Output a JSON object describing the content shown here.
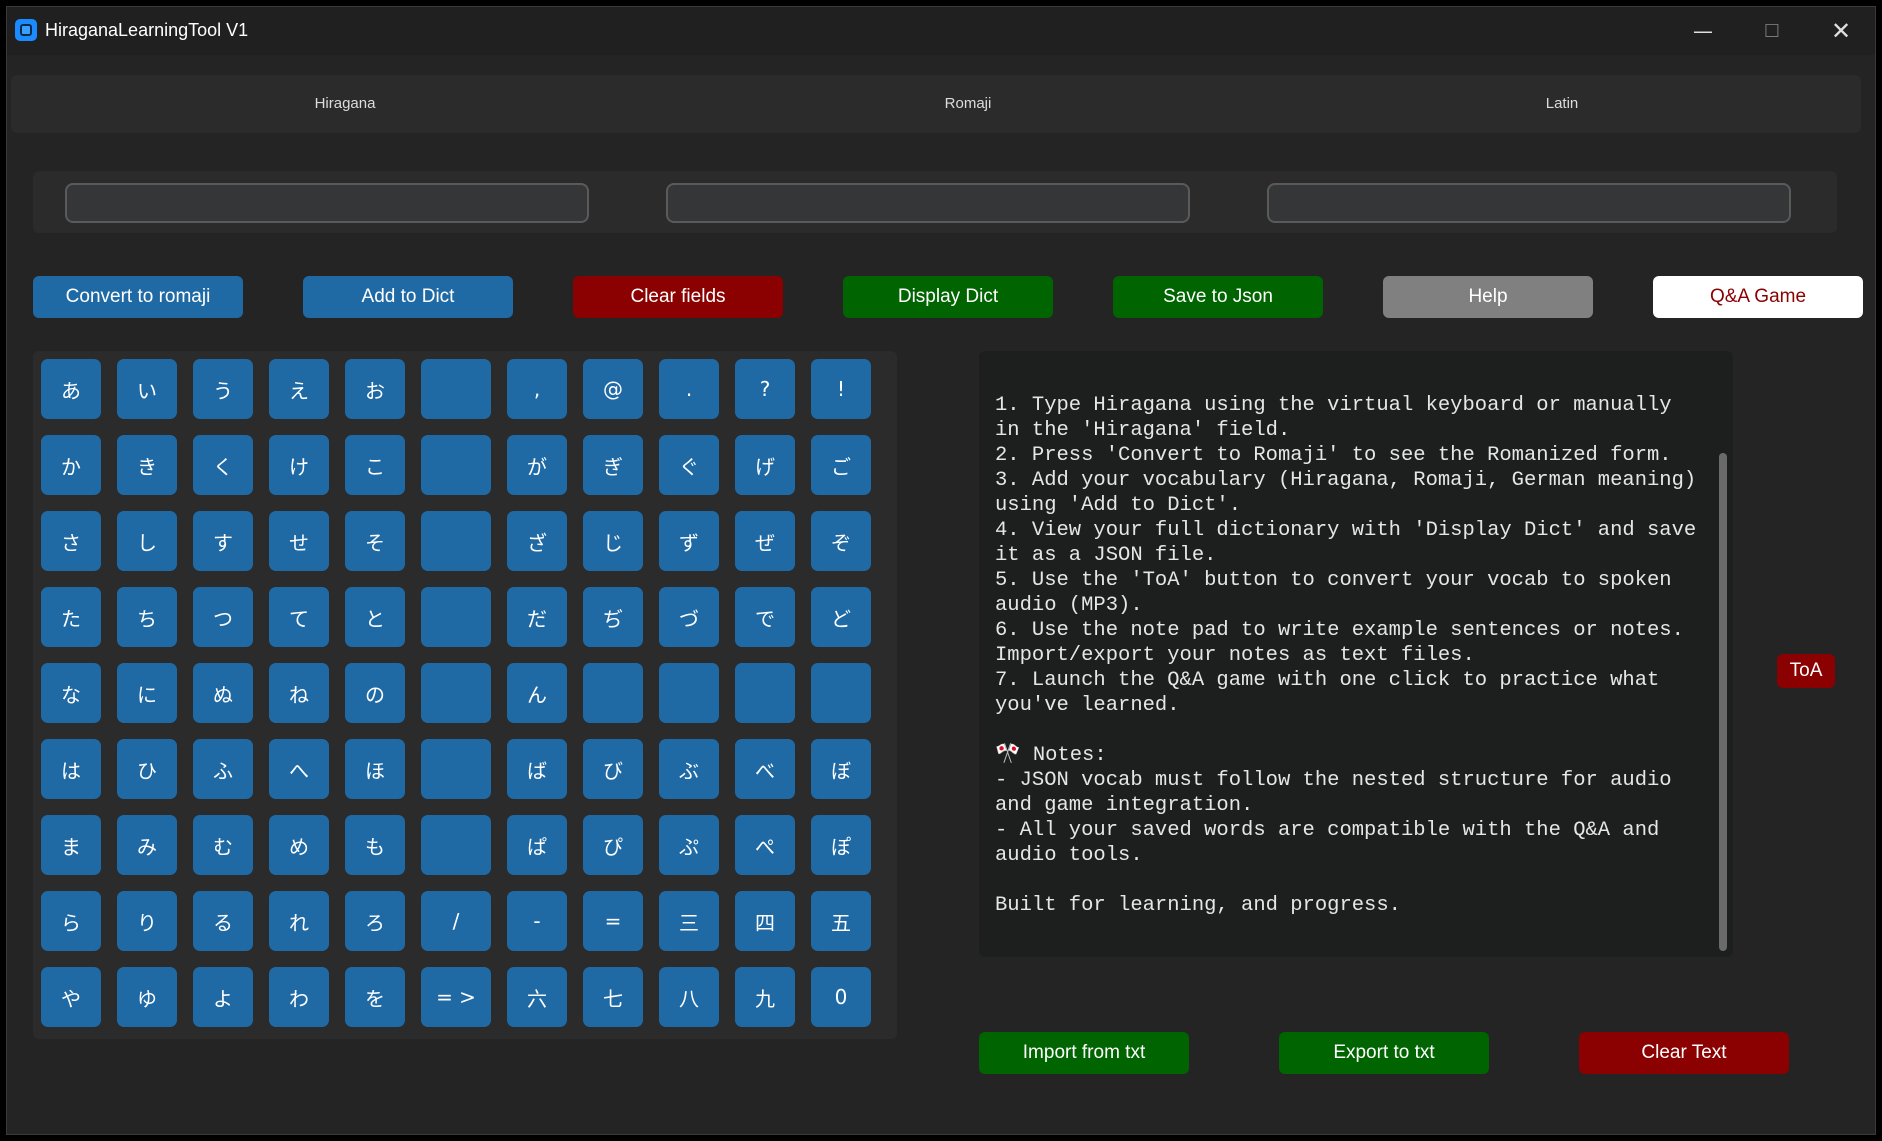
{
  "window": {
    "title": "HiraganaLearningTool V1",
    "minimize": "—",
    "maximize": "☐",
    "close": "✕"
  },
  "header": {
    "labels": [
      "Hiragana",
      "Romaji",
      "Latin"
    ]
  },
  "fields": {
    "hiragana_value": "",
    "romaji_value": "",
    "latin_value": ""
  },
  "actions": {
    "convert": "Convert to romaji",
    "add": "Add to Dict",
    "clear_fields": "Clear fields",
    "display": "Display Dict",
    "save": "Save to Json",
    "help": "Help",
    "game": "Q&A Game"
  },
  "keyboard": {
    "rows": [
      [
        "あ",
        "い",
        "う",
        "え",
        "お",
        "",
        ",",
        "@",
        ".",
        "?",
        "!"
      ],
      [
        "か",
        "き",
        "く",
        "け",
        "こ",
        "",
        "が",
        "ぎ",
        "ぐ",
        "げ",
        "ご"
      ],
      [
        "さ",
        "し",
        "す",
        "せ",
        "そ",
        "",
        "ざ",
        "じ",
        "ず",
        "ぜ",
        "ぞ"
      ],
      [
        "た",
        "ち",
        "つ",
        "て",
        "と",
        "",
        "だ",
        "ぢ",
        "づ",
        "で",
        "ど"
      ],
      [
        "な",
        "に",
        "ぬ",
        "ね",
        "の",
        "",
        "ん",
        "",
        "",
        "",
        ""
      ],
      [
        "は",
        "ひ",
        "ふ",
        "へ",
        "ほ",
        "",
        "ば",
        "び",
        "ぶ",
        "べ",
        "ぼ"
      ],
      [
        "ま",
        "み",
        "む",
        "め",
        "も",
        "",
        "ぱ",
        "ぴ",
        "ぷ",
        "ぺ",
        "ぽ"
      ],
      [
        "ら",
        "り",
        "る",
        "れ",
        "ろ",
        "/",
        "-",
        "=",
        "三",
        "四",
        "五"
      ],
      [
        "や",
        "ゆ",
        "よ",
        "わ",
        "を",
        "= >",
        "六",
        "七",
        "八",
        "九",
        "0"
      ]
    ]
  },
  "notes": {
    "text": "1. Type Hiragana using the virtual keyboard or manually in the 'Hiragana' field.\n2. Press 'Convert to Romaji' to see the Romanized form.\n3. Add your vocabulary (Hiragana, Romaji, German meaning) using 'Add to Dict'.\n4. View your full dictionary with 'Display Dict' and save it as a JSON file.\n5. Use the 'ToA' button to convert your vocab to spoken audio (MP3).\n6. Use the note pad to write example sentences or notes. Import/export your notes as text files.\n7. Launch the Q&A game with one click to practice what you've learned.\n\n🎌 Notes:\n- JSON vocab must follow the nested structure for audio and game integration.\n- All your saved words are compatible with the Q&A and audio tools.\n\nBuilt for learning, and progress."
  },
  "toa": {
    "label": "ToA"
  },
  "bottom": {
    "import": "Import from txt",
    "export": "Export to txt",
    "clear_text": "Clear Text"
  },
  "colors": {
    "blue": "#1f6aa5",
    "red": "#8b0000",
    "green": "#006400",
    "grey": "#808080",
    "background": "#242424"
  }
}
